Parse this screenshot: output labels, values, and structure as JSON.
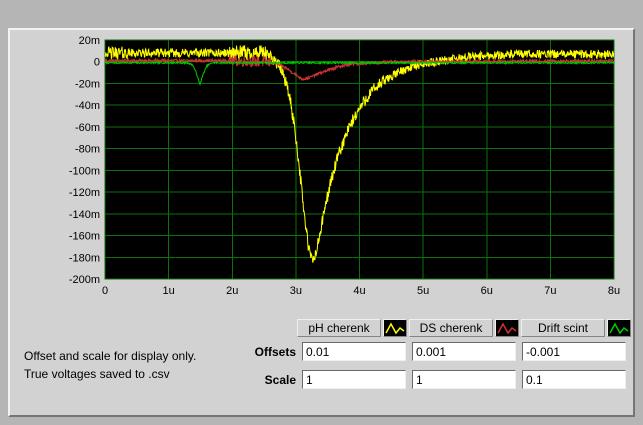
{
  "window": {
    "frame_color": "#b5b5b5",
    "panel_color": "#d2d2d2"
  },
  "note": {
    "line1": "Offset and scale for display only.",
    "line2": "True voltages saved to .csv"
  },
  "controls": {
    "offsets_label": "Offsets",
    "scale_label": "Scale",
    "offsets": [
      "0.01",
      "0.001",
      "-0.001"
    ],
    "scales": [
      "1",
      "1",
      "0.1"
    ]
  },
  "legend": {
    "items": [
      {
        "label": "pH cherenk",
        "color": "#ffff00"
      },
      {
        "label": "DS cherenk",
        "color": "#cc3434"
      },
      {
        "label": "Drift scint",
        "color": "#00cc00"
      }
    ]
  },
  "chart_data": {
    "type": "line",
    "bg": "#000000",
    "grid": true,
    "grid_color": "#0c720c",
    "x_max_us": 8,
    "ylim_V": [
      -0.2,
      0.02
    ],
    "x_ticks": [
      {
        "v": 0,
        "label": "0"
      },
      {
        "v": 1,
        "label": "1u"
      },
      {
        "v": 2,
        "label": "2u"
      },
      {
        "v": 3,
        "label": "3u"
      },
      {
        "v": 4,
        "label": "4u"
      },
      {
        "v": 5,
        "label": "5u"
      },
      {
        "v": 6,
        "label": "6u"
      },
      {
        "v": 7,
        "label": "7u"
      },
      {
        "v": 8,
        "label": "8u"
      }
    ],
    "y_ticks": [
      {
        "v": 0.02,
        "label": "20m"
      },
      {
        "v": 0,
        "label": "0"
      },
      {
        "v": -0.02,
        "label": "-20m"
      },
      {
        "v": -0.04,
        "label": "-40m"
      },
      {
        "v": -0.06,
        "label": "-60m"
      },
      {
        "v": -0.08,
        "label": "-80m"
      },
      {
        "v": -0.1,
        "label": "-100m"
      },
      {
        "v": -0.12,
        "label": "-120m"
      },
      {
        "v": -0.14,
        "label": "-140m"
      },
      {
        "v": -0.16,
        "label": "-160m"
      },
      {
        "v": -0.18,
        "label": "-180m"
      },
      {
        "v": -0.2,
        "label": "-200m"
      }
    ],
    "series": [
      {
        "name": "pH cherenk",
        "color": "#ffff00",
        "seed": 42,
        "noise_mV": 4,
        "noise_regions": [
          [
            0.05,
            0.35,
            6
          ],
          [
            1.95,
            2.55,
            7
          ],
          [
            2.6,
            4.4,
            6
          ]
        ],
        "anchors_us_mV": [
          [
            0,
            8
          ],
          [
            2.5,
            8
          ],
          [
            2.62,
            4
          ],
          [
            2.72,
            -2
          ],
          [
            2.82,
            -14
          ],
          [
            2.9,
            -32
          ],
          [
            2.98,
            -60
          ],
          [
            3.06,
            -100
          ],
          [
            3.14,
            -145
          ],
          [
            3.2,
            -172
          ],
          [
            3.26,
            -184
          ],
          [
            3.32,
            -176
          ],
          [
            3.4,
            -152
          ],
          [
            3.48,
            -128
          ],
          [
            3.56,
            -108
          ],
          [
            3.66,
            -88
          ],
          [
            3.76,
            -72
          ],
          [
            3.86,
            -58
          ],
          [
            3.96,
            -47
          ],
          [
            4.1,
            -34
          ],
          [
            4.25,
            -24
          ],
          [
            4.4,
            -17
          ],
          [
            4.6,
            -10
          ],
          [
            4.8,
            -5
          ],
          [
            5.0,
            -2
          ],
          [
            5.4,
            2
          ],
          [
            5.8,
            5
          ],
          [
            6.5,
            7
          ],
          [
            8,
            7
          ]
        ]
      },
      {
        "name": "DS cherenk",
        "color": "#cc3434",
        "seed": 1234,
        "noise_mV": 1.3,
        "noise_regions": [
          [
            1.95,
            2.6,
            5
          ]
        ],
        "anchors_us_mV": [
          [
            0,
            1
          ],
          [
            1.9,
            1
          ],
          [
            2.5,
            0
          ],
          [
            2.7,
            -2
          ],
          [
            2.85,
            -6
          ],
          [
            3.0,
            -12
          ],
          [
            3.1,
            -16
          ],
          [
            3.2,
            -15
          ],
          [
            3.35,
            -11
          ],
          [
            3.5,
            -8
          ],
          [
            3.7,
            -4
          ],
          [
            3.9,
            -2
          ],
          [
            4.2,
            -1
          ],
          [
            4.6,
            0
          ],
          [
            8,
            1
          ]
        ]
      },
      {
        "name": "Drift scint",
        "color": "#00cc00",
        "seed": 7,
        "noise_mV": 0.7,
        "noise_regions": [],
        "anchors_us_mV": [
          [
            0,
            -1
          ],
          [
            1.3,
            -1
          ],
          [
            1.38,
            -3
          ],
          [
            1.44,
            -11
          ],
          [
            1.49,
            -21
          ],
          [
            1.54,
            -12
          ],
          [
            1.6,
            -4
          ],
          [
            1.68,
            -1
          ],
          [
            8,
            -1
          ]
        ]
      }
    ]
  }
}
